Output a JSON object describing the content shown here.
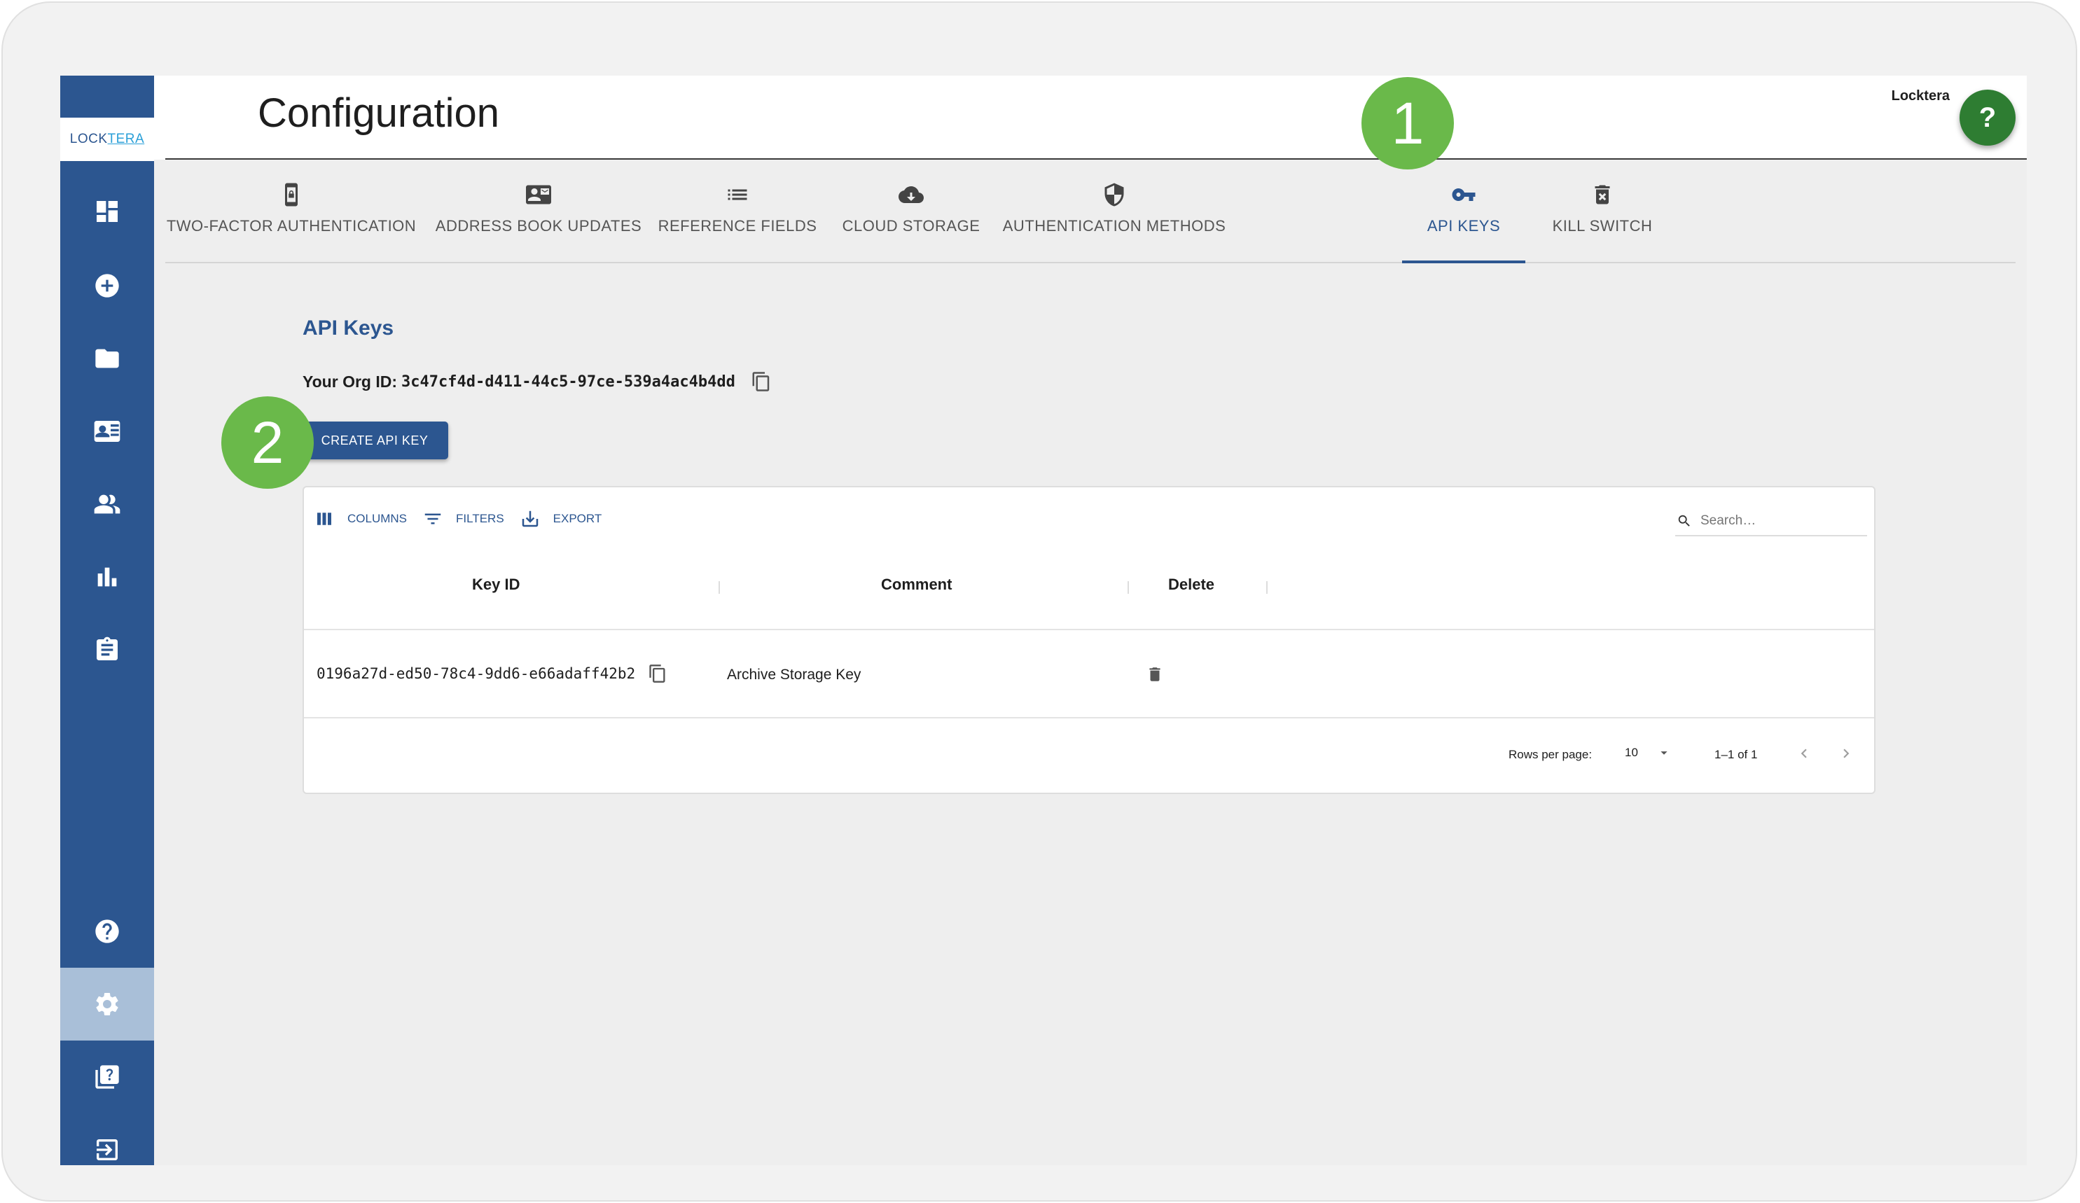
{
  "app": {
    "logo": {
      "part1": "LOCK",
      "part2": "TERA"
    },
    "org_name": "Locktera",
    "help_label": "?"
  },
  "header": {
    "title": "Configuration"
  },
  "sidebar": {
    "items": [
      {
        "name": "dashboard-icon",
        "active": false
      },
      {
        "name": "add-circle-icon",
        "active": false
      },
      {
        "name": "folder-icon",
        "active": false
      },
      {
        "name": "contact-card-icon",
        "active": false
      },
      {
        "name": "people-icon",
        "active": false
      },
      {
        "name": "bar-chart-icon",
        "active": false
      },
      {
        "name": "clipboard-icon",
        "active": false
      },
      {
        "name": "help-circle-icon",
        "active": false
      },
      {
        "name": "gear-icon",
        "active": true
      },
      {
        "name": "help-book-icon",
        "active": false
      },
      {
        "name": "logout-icon",
        "active": false
      }
    ]
  },
  "tabs": [
    {
      "label": "TWO-FACTOR AUTHENTICATION",
      "icon": "phone-lock-icon"
    },
    {
      "label": "ADDRESS BOOK UPDATES",
      "icon": "contact-mail-icon"
    },
    {
      "label": "REFERENCE FIELDS",
      "icon": "list-icon"
    },
    {
      "label": "CLOUD STORAGE",
      "icon": "cloud-sync-icon"
    },
    {
      "label": "AUTHENTICATION METHODS",
      "icon": "shield-icon"
    },
    {
      "label": "API KEYS",
      "icon": "key-icon",
      "active": true
    },
    {
      "label": "KILL SWITCH",
      "icon": "delete-x-icon"
    }
  ],
  "api_keys": {
    "title": "API Keys",
    "org_id_label": "Your Org ID:",
    "org_id": "3c47cf4d-d411-44c5-97ce-539a4ac4b4dd",
    "create_button": "CREATE API KEY"
  },
  "grid": {
    "toolbar": {
      "columns": "COLUMNS",
      "filters": "FILTERS",
      "export": "EXPORT"
    },
    "search_placeholder": "Search…",
    "columns": [
      "Key ID",
      "Comment",
      "Delete"
    ],
    "rows": [
      {
        "key_id": "0196a27d-ed50-78c4-9dd6-e66adaff42b2",
        "comment": "Archive Storage Key"
      }
    ],
    "footer": {
      "rows_per_page_label": "Rows per page:",
      "rows_per_page": "10",
      "range": "1–1 of 1"
    }
  },
  "callouts": [
    "1",
    "2"
  ],
  "colors": {
    "primary": "#2c5690",
    "callout": "#6ab94a",
    "help_fab": "#2e7d32"
  }
}
